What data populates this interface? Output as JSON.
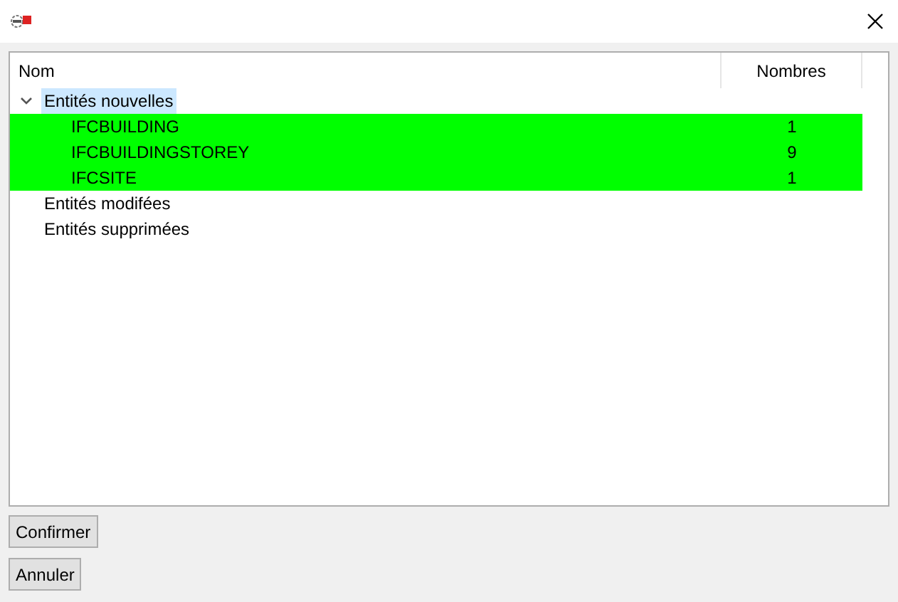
{
  "tree": {
    "columns": [
      "Nom",
      "Nombres"
    ],
    "items": [
      {
        "label": "Entités nouvelles",
        "selected": true,
        "expanded": true,
        "children": [
          {
            "label": "IFCBUILDING",
            "count": "1",
            "color": "#00ff00"
          },
          {
            "label": "IFCBUILDINGSTOREY",
            "count": "9",
            "color": "#00ff00"
          },
          {
            "label": "IFCSITE",
            "count": "1",
            "color": "#00ff00"
          }
        ]
      },
      {
        "label": "Entités modifées",
        "selected": false
      },
      {
        "label": "Entités supprimées",
        "selected": false
      }
    ]
  },
  "buttons": [
    "Confirmer",
    "Annuler"
  ]
}
